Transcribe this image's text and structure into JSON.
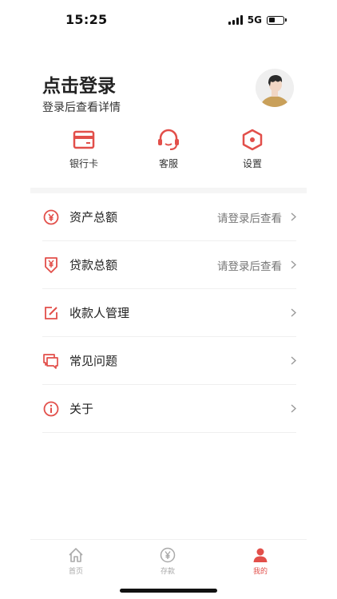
{
  "status_bar": {
    "time": "15:25",
    "network": "5G"
  },
  "header": {
    "title": "点击登录",
    "subtitle": "登录后查看详情"
  },
  "quick_actions": [
    {
      "label": "银行卡",
      "icon": "card-icon"
    },
    {
      "label": "客服",
      "icon": "headset-icon"
    },
    {
      "label": "设置",
      "icon": "settings-icon"
    }
  ],
  "menu": [
    {
      "label": "资产总额",
      "value": "请登录后查看",
      "icon": "yen-circle-icon"
    },
    {
      "label": "贷款总额",
      "value": "请登录后查看",
      "icon": "loan-icon"
    },
    {
      "label": "收款人管理",
      "value": "",
      "icon": "edit-icon"
    },
    {
      "label": "常见问题",
      "value": "",
      "icon": "faq-icon"
    },
    {
      "label": "关于",
      "value": "",
      "icon": "info-icon"
    }
  ],
  "tabs": [
    {
      "label": "首页",
      "icon": "home-icon",
      "active": false
    },
    {
      "label": "存款",
      "icon": "deposit-icon",
      "active": false
    },
    {
      "label": "我的",
      "icon": "profile-icon",
      "active": true
    }
  ],
  "colors": {
    "accent": "#e24f4a",
    "muted": "#aaaaaa",
    "text": "#222222"
  }
}
